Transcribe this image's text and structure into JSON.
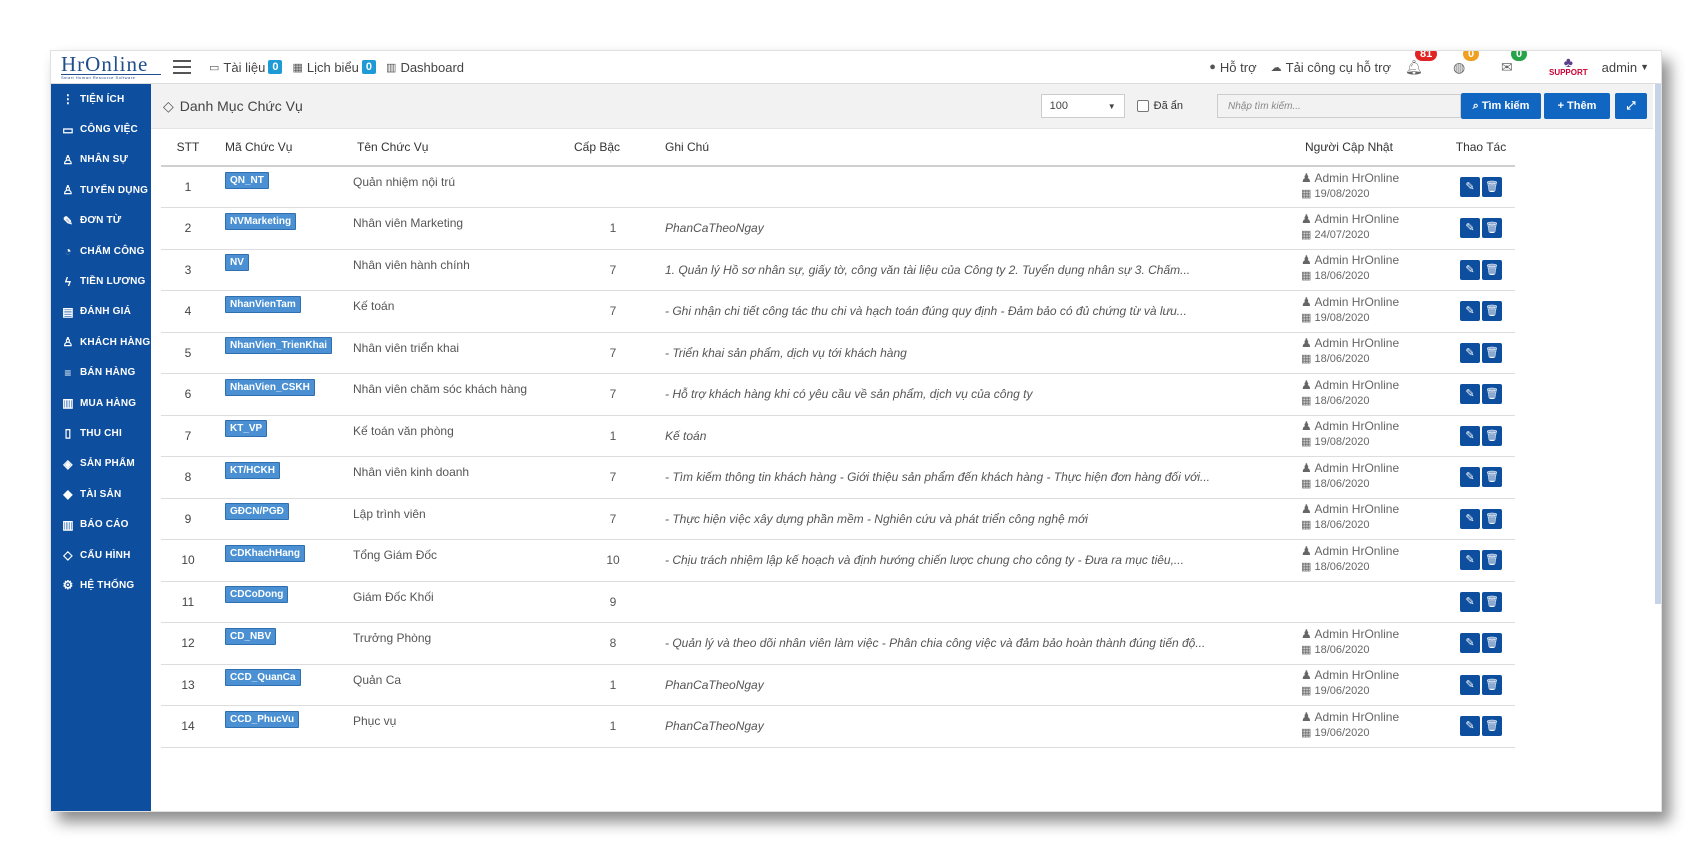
{
  "app": {
    "logo_text": "HrOnline",
    "logo_sub": "Smart Human Resource Software"
  },
  "topbar": {
    "links": [
      {
        "label": "Tài liệu",
        "badge": "0"
      },
      {
        "label": "Lịch biểu",
        "badge": "0"
      },
      {
        "label": "Dashboard"
      }
    ],
    "help": "Hỗ trợ",
    "tools": "Tải công cụ hỗ trợ",
    "notif_counts": [
      "81",
      "0",
      "0"
    ],
    "support_label": "SUPPORT",
    "user": "admin"
  },
  "sidebar": {
    "items": [
      {
        "label": "TIỆN ÍCH",
        "icon": "more-vertical-icon"
      },
      {
        "label": "CÔNG VIỆC",
        "icon": "inbox-icon"
      },
      {
        "label": "NHÂN SỰ",
        "icon": "user-icon"
      },
      {
        "label": "TUYỂN DỤNG",
        "icon": "user-add-icon"
      },
      {
        "label": "ĐƠN TỪ",
        "icon": "edit-icon"
      },
      {
        "label": "CHẤM CÔNG",
        "icon": "clock-icon"
      },
      {
        "label": "TIỀN LƯƠNG",
        "icon": "bolt-icon"
      },
      {
        "label": "ĐÁNH GIÁ",
        "icon": "book-icon"
      },
      {
        "label": "KHÁCH HÀNG",
        "icon": "customer-icon"
      },
      {
        "label": "BÁN HÀNG",
        "icon": "list-icon"
      },
      {
        "label": "MUA HÀNG",
        "icon": "columns-icon"
      },
      {
        "label": "THU CHI",
        "icon": "document-icon"
      },
      {
        "label": "SẢN PHẨM",
        "icon": "tag-icon"
      },
      {
        "label": "TÀI SẢN",
        "icon": "diamond-icon"
      },
      {
        "label": "BÁO CÁO",
        "icon": "chart-icon"
      },
      {
        "label": "CẤU HÌNH",
        "icon": "layers-icon"
      },
      {
        "label": "HỆ THỐNG",
        "icon": "gear-icon"
      }
    ]
  },
  "panel": {
    "title": "Danh Mục Chức Vụ",
    "page_size": "100",
    "hidden_label": "Đã ẩn",
    "search_placeholder": "Nhập tìm kiếm...",
    "search_button": "Tìm kiếm",
    "add_button": "Thêm"
  },
  "table": {
    "headers": [
      "STT",
      "Mã Chức Vụ",
      "Tên Chức Vụ",
      "Cấp Bậc",
      "Ghi Chú",
      "Người Cập Nhật",
      "Thao Tác"
    ],
    "rows": [
      {
        "stt": "1",
        "code": "QN_NT",
        "name": "Quản nhiệm nội trú",
        "level": "",
        "note": "",
        "user": "Admin HrOnline",
        "date": "19/08/2020"
      },
      {
        "stt": "2",
        "code": "NVMarketing",
        "name": "Nhân viên Marketing",
        "level": "1",
        "note": "PhanCaTheoNgay",
        "user": "Admin HrOnline",
        "date": "24/07/2020"
      },
      {
        "stt": "3",
        "code": "NV",
        "name": "Nhân viên hành chính",
        "level": "7",
        "note": "1. Quản lý Hồ sơ nhân sự, giấy tờ, công văn tài liệu của Công ty 2. Tuyển dụng nhân sự 3. Chấm...",
        "user": "Admin HrOnline",
        "date": "18/06/2020"
      },
      {
        "stt": "4",
        "code": "NhanVienTam",
        "name": "Kế toán",
        "level": "7",
        "note": "- Ghi nhận chi tiết công tác thu chi và hạch toán đúng quy định - Đảm bảo có đủ chứng từ và lưu...",
        "user": "Admin HrOnline",
        "date": "19/08/2020"
      },
      {
        "stt": "5",
        "code": "NhanVien_TrienKhai",
        "name": "Nhân viên triển khai",
        "level": "7",
        "note": "- Triển khai sản phẩm, dịch vụ tới khách hàng",
        "user": "Admin HrOnline",
        "date": "18/06/2020"
      },
      {
        "stt": "6",
        "code": "NhanVien_CSKH",
        "name": "Nhân viên chăm sóc khách hàng",
        "level": "7",
        "note": "- Hỗ trợ khách hàng khi có yêu cầu về sản phẩm, dịch vụ của công ty",
        "user": "Admin HrOnline",
        "date": "18/06/2020"
      },
      {
        "stt": "7",
        "code": "KT_VP",
        "name": "Kế toán văn phòng",
        "level": "1",
        "note": "Kế toán",
        "user": "Admin HrOnline",
        "date": "19/08/2020"
      },
      {
        "stt": "8",
        "code": "KT/HCKH",
        "name": "Nhân viên kinh doanh",
        "level": "7",
        "note": "- Tìm kiếm thông tin khách hàng - Giới thiệu sản phẩm đến khách hàng - Thực hiện đơn hàng đối với...",
        "user": "Admin HrOnline",
        "date": "18/06/2020"
      },
      {
        "stt": "9",
        "code": "GĐCN/PGĐ",
        "name": "Lập trình viên",
        "level": "7",
        "note": "- Thực hiện việc xây dựng phần mềm - Nghiên cứu và phát triển công nghệ mới",
        "user": "Admin HrOnline",
        "date": "18/06/2020"
      },
      {
        "stt": "10",
        "code": "CDKhachHang",
        "name": "Tổng Giám Đốc",
        "level": "10",
        "note": "- Chịu trách nhiệm lập kế hoạch và định hướng chiến lược chung cho công ty - Đưa ra mục tiêu,...",
        "user": "Admin HrOnline",
        "date": "18/06/2020"
      },
      {
        "stt": "11",
        "code": "CDCoDong",
        "name": "Giám Đốc Khối",
        "level": "9",
        "note": "",
        "user": "",
        "date": ""
      },
      {
        "stt": "12",
        "code": "CD_NBV",
        "name": "Trưởng Phòng",
        "level": "8",
        "note": "- Quản lý và theo dõi nhân viên làm việc - Phân chia công việc và đảm bảo hoàn thành đúng tiến độ...",
        "user": "Admin HrOnline",
        "date": "18/06/2020"
      },
      {
        "stt": "13",
        "code": "CCD_QuanCa",
        "name": "Quản Ca",
        "level": "1",
        "note": "PhanCaTheoNgay",
        "user": "Admin HrOnline",
        "date": "19/06/2020"
      },
      {
        "stt": "14",
        "code": "CCD_PhucVu",
        "name": "Phục vụ",
        "level": "1",
        "note": "PhanCaTheoNgay",
        "user": "Admin HrOnline",
        "date": "19/06/2020"
      }
    ]
  },
  "colors": {
    "sidebar": "#0d4e9e",
    "badge": "#4a90d2",
    "button": "#1166c2"
  }
}
